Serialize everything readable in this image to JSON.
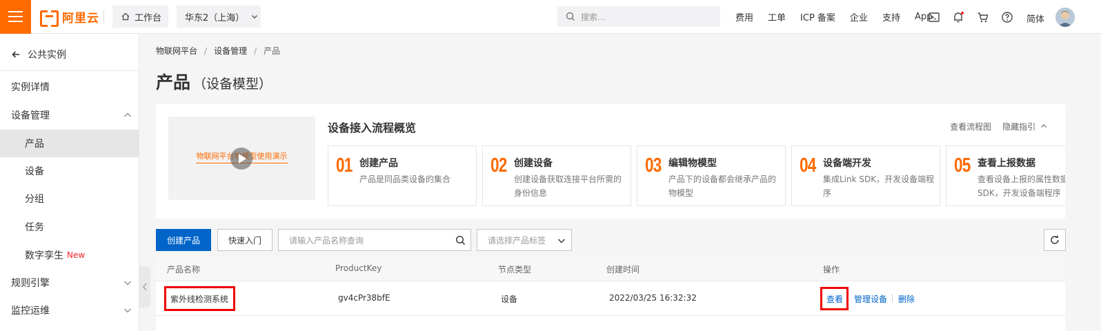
{
  "topbar": {
    "brand": "阿里云",
    "workbench": "工作台",
    "region": "华东2（上海）",
    "search_placeholder": "搜索...",
    "links": [
      "费用",
      "工单",
      "ICP 备案",
      "企业",
      "支持",
      "App"
    ],
    "language": "简体",
    "accent": "#ff6a00"
  },
  "sidebar": {
    "back_label": "公共实例",
    "items": [
      {
        "label": "实例详情"
      },
      {
        "label": "设备管理"
      },
      {
        "label": "产品"
      },
      {
        "label": "设备"
      },
      {
        "label": "分组"
      },
      {
        "label": "任务"
      },
      {
        "label": "数字孪生",
        "badge": "New"
      },
      {
        "label": "规则引擎"
      },
      {
        "label": "监控运维"
      }
    ]
  },
  "breadcrumb": [
    "物联网平台",
    "设备管理",
    "产品"
  ],
  "page": {
    "title": "产品",
    "title_sub": "（设备模型）"
  },
  "guide": {
    "video_caption": "物联网平台物模型使用演示",
    "title": "设备接入流程概览",
    "view_flow": "查看流程图",
    "hide_guide": "隐藏指引",
    "steps": [
      {
        "num": "01",
        "title": "创建产品",
        "desc": "产品是同品类设备的集合"
      },
      {
        "num": "02",
        "title": "创建设备",
        "desc": "创建设备获取连接平台所需的身份信息"
      },
      {
        "num": "03",
        "title": "编辑物模型",
        "desc": "产品下的设备都会继承产品的物模型"
      },
      {
        "num": "04",
        "title": "设备端开发",
        "desc": "集成Link SDK，开发设备端程序"
      },
      {
        "num": "05",
        "title": "查看上报数据",
        "desc": "查看设备上报的属性数据SDK，开发设备端程序"
      }
    ]
  },
  "toolbar": {
    "create_label": "创建产品",
    "quickstart_label": "快速入门",
    "search_placeholder": "请输入产品名称查询",
    "tag_placeholder": "请选择产品标签"
  },
  "table": {
    "columns": [
      "产品名称",
      "ProductKey",
      "节点类型",
      "创建时间",
      "操作"
    ],
    "rows": [
      {
        "name": "紫外线检测系统",
        "product_key": "gv4cPr38bfE",
        "node_type": "设备",
        "created": "2022/03/25 16:32:32",
        "actions": [
          "查看",
          "管理设备",
          "删除"
        ]
      }
    ]
  },
  "colors": {
    "primary": "#0064c8",
    "highlight": "#ee0000",
    "new_badge": "#f5222d"
  }
}
